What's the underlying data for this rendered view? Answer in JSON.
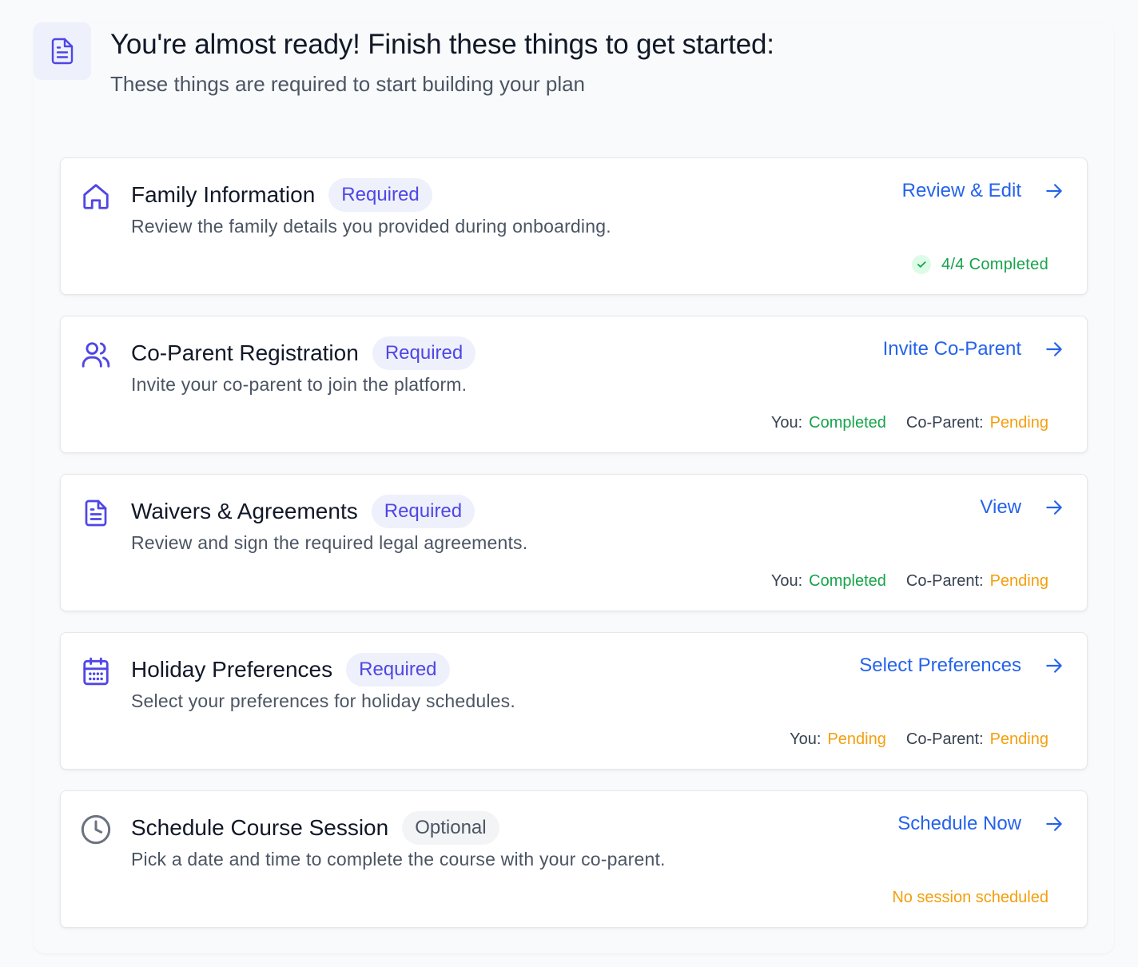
{
  "header": {
    "title": "You're almost ready! Finish these things to get started:",
    "subtitle": "These things are required to start building your plan",
    "icon": "document-icon"
  },
  "tasks": [
    {
      "icon": "home-icon",
      "title": "Family Information",
      "badge": "Required",
      "description": "Review the family details you provided during onboarding.",
      "action": "Review & Edit",
      "progress": "4/4 Completed"
    },
    {
      "icon": "users-icon",
      "title": "Co-Parent Registration",
      "badge": "Required",
      "description": "Invite your co-parent to join the platform.",
      "action": "Invite Co-Parent",
      "you_label": "You:",
      "you_status": "Completed",
      "coparent_label": "Co-Parent:",
      "coparent_status": "Pending"
    },
    {
      "icon": "document-icon",
      "title": "Waivers & Agreements",
      "badge": "Required",
      "description": "Review and sign the required legal agreements.",
      "action": "View",
      "you_label": "You:",
      "you_status": "Completed",
      "coparent_label": "Co-Parent:",
      "coparent_status": "Pending"
    },
    {
      "icon": "calendar-icon",
      "title": "Holiday Preferences",
      "badge": "Required",
      "description": "Select your preferences for holiday schedules.",
      "action": "Select Preferences",
      "you_label": "You:",
      "you_status": "Pending",
      "coparent_label": "Co-Parent:",
      "coparent_status": "Pending"
    },
    {
      "icon": "clock-icon",
      "title": "Schedule Course Session",
      "badge": "Optional",
      "description": "Pick a date and time to complete the course with your co-parent.",
      "action": "Schedule Now",
      "status_note": "No session scheduled"
    }
  ],
  "colors": {
    "accent": "#4f46e5",
    "link": "#2563eb",
    "completed": "#16a34a",
    "pending": "#f59e0b"
  }
}
